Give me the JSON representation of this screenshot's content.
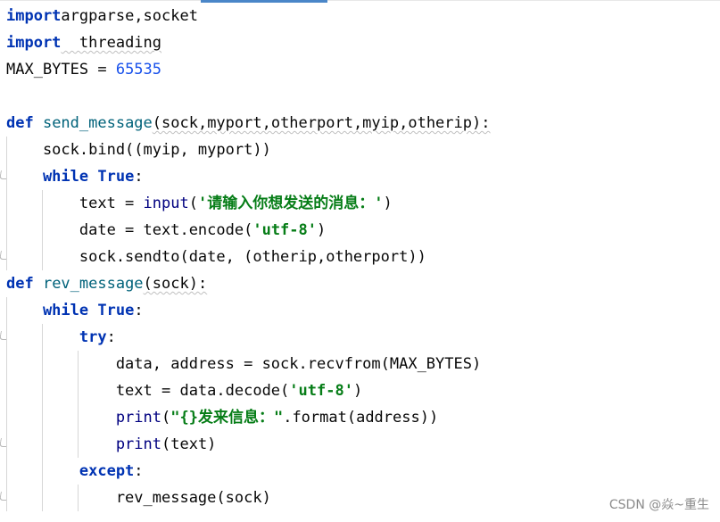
{
  "editor": {
    "lines": [
      {
        "tokens": [
          [
            "kw",
            "import"
          ],
          [
            "",
            "argparse,socket"
          ]
        ]
      },
      {
        "tokens": [
          [
            "kw",
            "import"
          ],
          [
            "",
            "  threading"
          ]
        ]
      },
      {
        "tokens": [
          [
            "",
            "MAX_BYTES = "
          ],
          [
            "num",
            "65535"
          ]
        ]
      },
      {
        "tokens": []
      },
      {
        "tokens": [
          [
            "kw",
            "def "
          ],
          [
            "fn",
            "send_message"
          ],
          [
            "",
            "(sock,myport,otherport,myip,otherip):"
          ]
        ]
      },
      {
        "tokens": [
          [
            "",
            "    sock.bind((myip, myport))"
          ]
        ]
      },
      {
        "tokens": [
          [
            "kw",
            "    while "
          ],
          [
            "kw",
            "True"
          ],
          [
            "",
            ":"
          ]
        ]
      },
      {
        "tokens": [
          [
            "",
            "        text = "
          ],
          [
            "builtin",
            "input"
          ],
          [
            "",
            "("
          ],
          [
            "str",
            "'请输入你想发送的消息：'"
          ],
          [
            "",
            ")"
          ]
        ]
      },
      {
        "tokens": [
          [
            "",
            "        date = text.encode("
          ],
          [
            "str",
            "'utf-8'"
          ],
          [
            "",
            ")"
          ]
        ]
      },
      {
        "tokens": [
          [
            "",
            "        sock.sendto(date, (otherip,otherport))"
          ]
        ]
      },
      {
        "tokens": [
          [
            "kw",
            "def "
          ],
          [
            "fn",
            "rev_message"
          ],
          [
            "",
            "(sock):"
          ]
        ]
      },
      {
        "tokens": [
          [
            "kw",
            "    while "
          ],
          [
            "kw",
            "True"
          ],
          [
            "",
            ":"
          ]
        ]
      },
      {
        "tokens": [
          [
            "kw",
            "        try"
          ],
          [
            "",
            ":"
          ]
        ]
      },
      {
        "tokens": [
          [
            "",
            "            data, address = sock.recvfrom(MAX_BYTES)"
          ]
        ]
      },
      {
        "tokens": [
          [
            "",
            "            text = data.decode("
          ],
          [
            "str",
            "'utf-8'"
          ],
          [
            "",
            ")"
          ]
        ]
      },
      {
        "tokens": [
          [
            "builtin",
            "            print"
          ],
          [
            "",
            "("
          ],
          [
            "str",
            "\"{}发来信息：\""
          ],
          [
            "",
            ".format(address))"
          ]
        ]
      },
      {
        "tokens": [
          [
            "builtin",
            "            print"
          ],
          [
            "",
            "(text)"
          ]
        ]
      },
      {
        "tokens": [
          [
            "kw",
            "        except"
          ],
          [
            "",
            ":"
          ]
        ]
      },
      {
        "tokens": [
          [
            "",
            "            rev_message(sock)"
          ]
        ]
      }
    ]
  },
  "watermark": "CSDN @焱~重生"
}
